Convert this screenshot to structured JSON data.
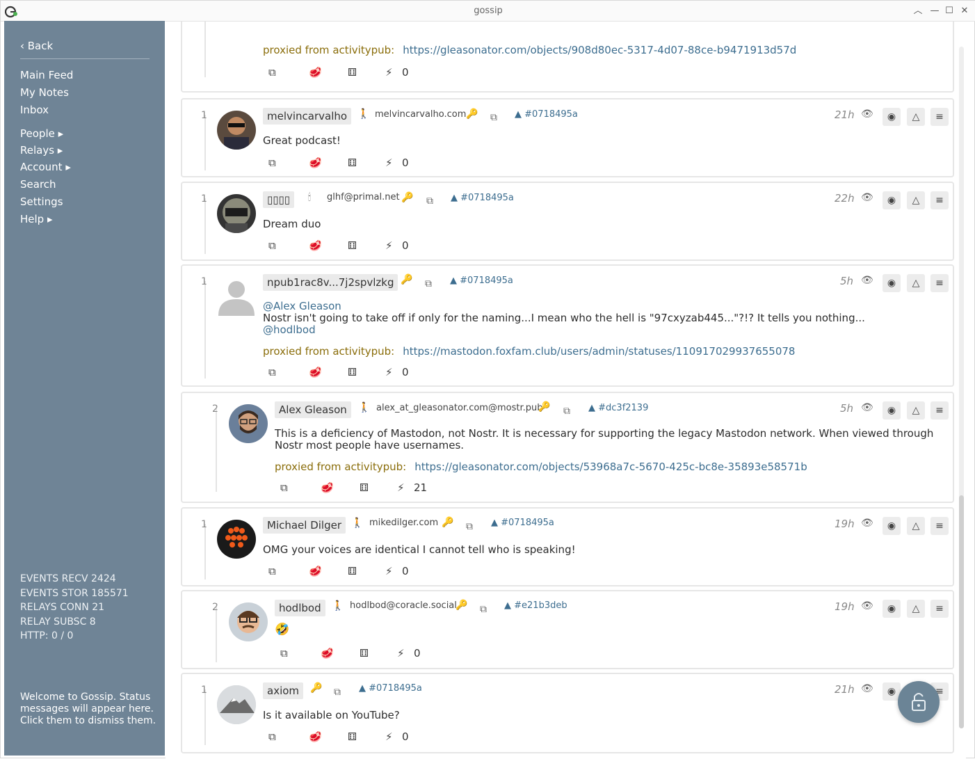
{
  "window": {
    "title": "gossip"
  },
  "sidebar": {
    "back": "‹ Back",
    "items": [
      "Main Feed",
      "My Notes",
      "Inbox"
    ],
    "menus": [
      "People ▸",
      "Relays ▸",
      "Account ▸",
      "Search",
      "Settings",
      "Help ▸"
    ],
    "stats": [
      "EVENTS RECV 2424",
      "EVENTS STOR 185571",
      "RELAYS CONN 21",
      "RELAY SUBSC 8",
      "HTTP: 0 / 0"
    ],
    "welcome": "Welcome to Gossip. Status messages will appear here. Click them to dismiss them."
  },
  "top_partial": {
    "proxied_label": "proxied from activitypub:",
    "proxied_url": "https://gleasonator.com/objects/908d80ec-5317-4d07-88ce-b9471913d57d",
    "zaps": "0"
  },
  "posts": [
    {
      "depth": "1",
      "name": "melvincarvalho",
      "nip05": "melvincarvalho.com",
      "ref": "▲ #0718495a",
      "time": "21h",
      "content": "Great podcast!",
      "zaps": "0"
    },
    {
      "depth": "1",
      "name": "▯▯▯▯",
      "nip05": "glhf@primal.net",
      "ref": "▲ #0718495a",
      "time": "22h",
      "content": "Dream duo",
      "zaps": "0"
    },
    {
      "depth": "1",
      "name": "npub1rac8v...7j2spvlzkg",
      "ref": "▲ #0718495a",
      "time": "5h",
      "mention1": "@Alex Gleason",
      "content": "Nostr isn't going to take off if only for the naming...I mean who the hell is \"97cxyzab445...\"?!? It tells you nothing...",
      "mention2": "@hodlbod",
      "proxied_label": "proxied from activitypub:",
      "proxied_url": "https://mastodon.foxfam.club/users/admin/statuses/110917029937655078",
      "zaps": "0"
    },
    {
      "depth": "2",
      "name": "Alex Gleason",
      "nip05": "alex_at_gleasonator.com@mostr.pub",
      "ref": "▲ #dc3f2139",
      "time": "5h",
      "content": "This is a deficiency of Mastodon, not Nostr. It is necessary for supporting the legacy Mastodon network. When viewed through Nostr most people have usernames.",
      "proxied_label": "proxied from activitypub:",
      "proxied_url": "https://gleasonator.com/objects/53968a7c-5670-425c-bc8e-35893e58571b",
      "zaps": "21"
    },
    {
      "depth": "1",
      "name": "Michael Dilger",
      "nip05": "mikedilger.com",
      "ref": "▲ #0718495a",
      "time": "19h",
      "content": "OMG your voices are identical I cannot tell who is speaking!",
      "zaps": "0"
    },
    {
      "depth": "2",
      "name": "hodlbod",
      "nip05": "hodlbod@coracle.social",
      "ref": "▲ #e21b3deb",
      "time": "19h",
      "content": "🤣",
      "zaps": "0"
    },
    {
      "depth": "1",
      "name": "axiom",
      "ref": "▲ #0718495a",
      "time": "21h",
      "content": "Is it available on YouTube?",
      "zaps": "0"
    }
  ],
  "icons": {
    "copy": "copy-icon",
    "reply": "reply-icon",
    "dice": "dice-icon",
    "zap": "zap-icon",
    "eye": "eye-icon",
    "key": "key-icon",
    "walker": "walker-icon",
    "lock": "lock-icon"
  }
}
